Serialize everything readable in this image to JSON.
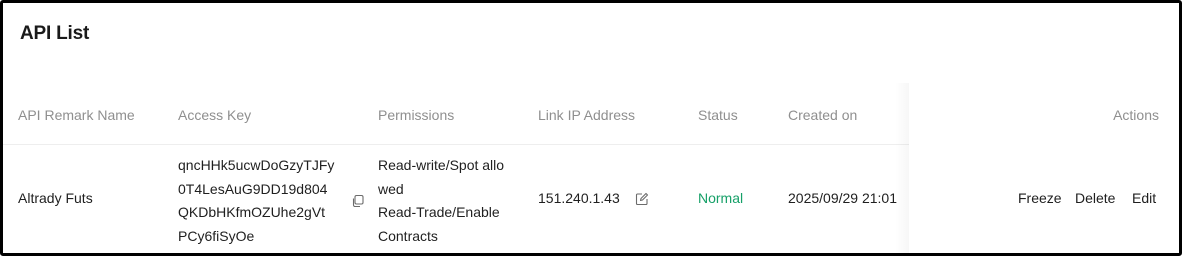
{
  "page": {
    "title": "API List"
  },
  "table": {
    "columns": {
      "remark_name": "API Remark Name",
      "access_key": "Access Key",
      "permissions": "Permissions",
      "link_ip": "Link IP Address",
      "status": "Status",
      "created_on": "Created on",
      "actions": "Actions"
    },
    "rows": [
      {
        "remark_name": "Altrady Futs",
        "access_key_lines": [
          "qncHHk5ucwDoGzyTJFy",
          "0T4LesAuG9DD19d804",
          "QKDbHKfmOZUhe2gVt",
          "PCy6fiSyOe"
        ],
        "permissions_lines": [
          "Read-write/Spot allo",
          "wed",
          "Read-Trade/Enable",
          "Contracts"
        ],
        "link_ip": "151.240.1.43",
        "status": "Normal",
        "created_on": "2025/09/29 21:01",
        "actions": {
          "freeze": "Freeze",
          "delete": "Delete",
          "edit": "Edit"
        }
      }
    ]
  },
  "colors": {
    "status_normal": "#16a068",
    "header_text": "#8f8f8f",
    "body_text": "#1f1f1f"
  },
  "icons": {
    "copy": "copy-icon",
    "edit": "pencil-edit-icon"
  }
}
